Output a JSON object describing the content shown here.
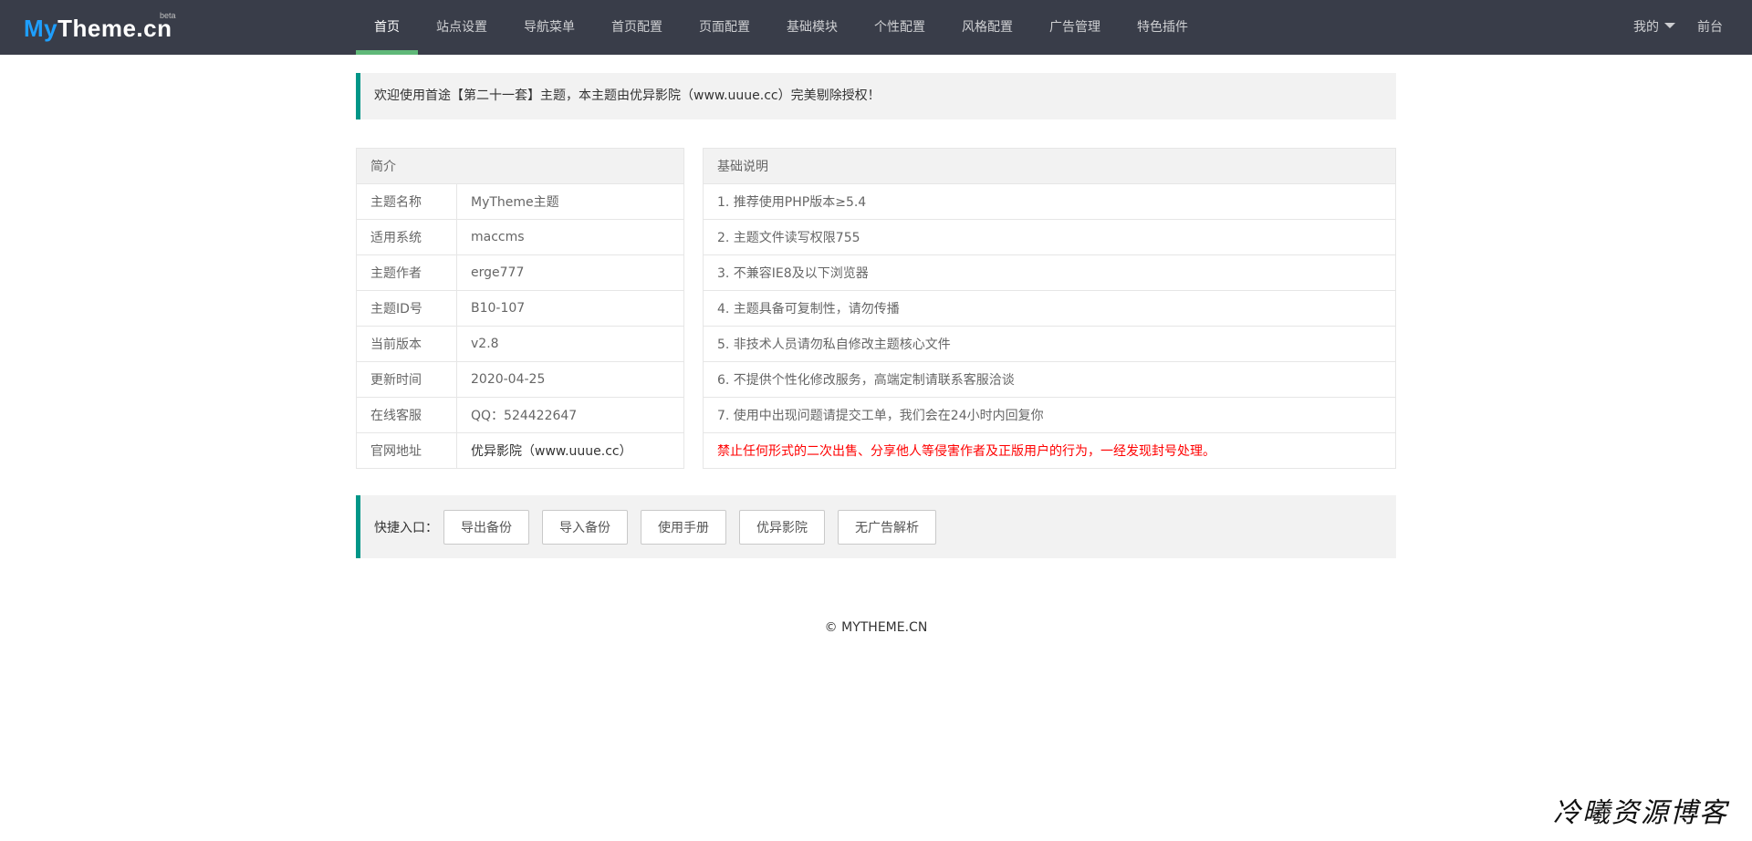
{
  "header": {
    "logo": {
      "my": "My",
      "rest": "Theme.",
      "cn": "cn",
      "beta": "beta"
    },
    "nav": [
      {
        "label": "首页",
        "active": true
      },
      {
        "label": "站点设置"
      },
      {
        "label": "导航菜单"
      },
      {
        "label": "首页配置"
      },
      {
        "label": "页面配置"
      },
      {
        "label": "基础模块"
      },
      {
        "label": "个性配置"
      },
      {
        "label": "风格配置"
      },
      {
        "label": "广告管理"
      },
      {
        "label": "特色插件"
      }
    ],
    "right": {
      "mine": "我的",
      "front": "前台"
    }
  },
  "notice": "欢迎使用首途【第二十一套】主题，本主题由优异影院（www.uuue.cc）完美剔除授权！",
  "intro": {
    "title": "简介",
    "rows": [
      {
        "key": "主题名称",
        "value": "MyTheme主题"
      },
      {
        "key": "适用系统",
        "value": "maccms"
      },
      {
        "key": "主题作者",
        "value": "erge777"
      },
      {
        "key": "主题ID号",
        "value": "B10-107"
      },
      {
        "key": "当前版本",
        "value": "v2.8"
      },
      {
        "key": "更新时间",
        "value": "2020-04-25"
      },
      {
        "key": "在线客服",
        "value": "QQ：524422647"
      },
      {
        "key": "官网地址",
        "value": "优异影院（www.uuue.cc）"
      }
    ]
  },
  "basics": {
    "title": "基础说明",
    "items": [
      "1. 推荐使用PHP版本≥5.4",
      "2. 主题文件读写权限755",
      "3. 不兼容IE8及以下浏览器",
      "4. 主题具备可复制性，请勿传播",
      "5. 非技术人员请勿私自修改主题核心文件",
      "6. 不提供个性化修改服务，高端定制请联系客服洽谈",
      "7. 使用中出现问题请提交工单，我们会在24小时内回复你",
      "禁止任何形式的二次出售、分享他人等侵害作者及正版用户的行为，一经发现封号处理。"
    ],
    "warning_color": "#ff0000"
  },
  "quick": {
    "label": "快捷入口：",
    "buttons": [
      "导出备份",
      "导入备份",
      "使用手册",
      "优异影院",
      "无广告解析"
    ]
  },
  "footer": "© MYTHEME.CN",
  "watermark": "冷曦资源博客",
  "colors": {
    "header_bg": "#393d49",
    "accent": "#009688",
    "active_bar": "#5fb878"
  }
}
